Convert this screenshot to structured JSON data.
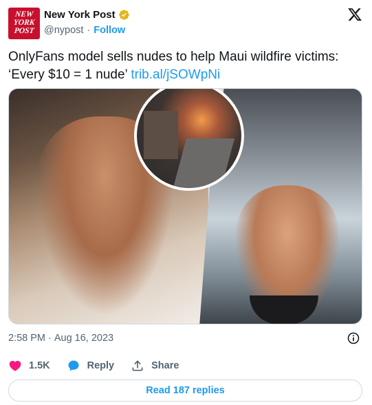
{
  "header": {
    "avatar_lines": [
      "NEW",
      "YORK",
      "POST"
    ],
    "account_name": "New York Post",
    "handle": "@nypost",
    "separator": "·",
    "follow_label": "Follow"
  },
  "tweet": {
    "text": "OnlyFans model sells nudes to help Maui wildfire victims: ‘Every $10 = 1 nude’ ",
    "link": "trib.al/jSOWpNi"
  },
  "meta": {
    "time": "2:58 PM",
    "separator": "·",
    "date": "Aug 16, 2023"
  },
  "actions": {
    "like_count": "1.5K",
    "reply_label": "Reply",
    "share_label": "Share"
  },
  "footer": {
    "read_replies_label": "Read 187 replies"
  },
  "colors": {
    "accent": "#1d9bf0",
    "like": "#f91880",
    "brand_red": "#c8102e",
    "verified_gold": "#e2b719",
    "text": "#0f1419",
    "muted": "#536471"
  },
  "icons": [
    "verified-badge-icon",
    "x-logo-icon",
    "info-icon",
    "heart-icon",
    "reply-bubble-icon",
    "share-icon"
  ]
}
